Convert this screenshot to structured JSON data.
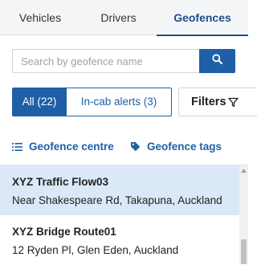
{
  "tabs": [
    {
      "label": "Vehicles",
      "active": false
    },
    {
      "label": "Drivers",
      "active": false
    },
    {
      "label": "Geofences",
      "active": true
    }
  ],
  "search": {
    "placeholder": "Search by geofence name",
    "value": "",
    "button_icon": "search-icon"
  },
  "segments": {
    "all_label": "All (22)",
    "in_cab_label": "In-cab alerts (3)",
    "selected": "all"
  },
  "filters": {
    "label": "Filters",
    "icon": "filter-icon"
  },
  "links": {
    "centre_label": "Geofence centre",
    "centre_icon": "list-icon",
    "tags_label": "Geofence tags",
    "tags_icon": "tag-icon"
  },
  "geofences": [
    {
      "name": "XYZ Traffic Flow03",
      "address": "Near Shakespeare Rd, Takapuna, Auckland",
      "selected": true
    },
    {
      "name": "XYZ Bridge Route01",
      "address": "12 Ryden Pl, Glen Eden, Auckland",
      "selected": false
    }
  ],
  "colors": {
    "accent": "#1f5fa8",
    "active_tab": "#1f4e8c",
    "selected_row": "#dbe8f7"
  }
}
